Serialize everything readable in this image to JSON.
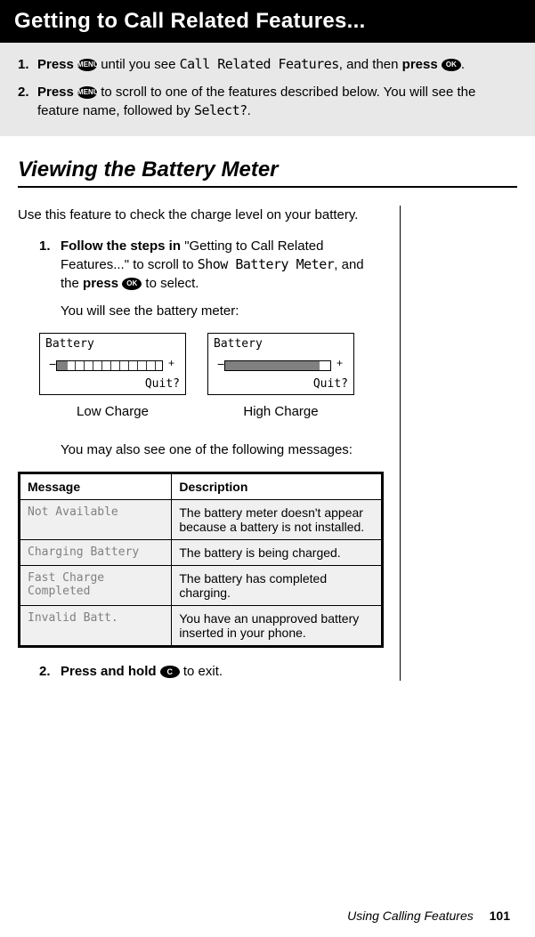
{
  "header": {
    "title": "Getting to Call Related Features..."
  },
  "steps": {
    "one_a": "Press ",
    "one_b": " until you see ",
    "one_menu": "Call Related Features",
    "one_c": ", and then ",
    "one_d": "press ",
    "one_e": ".",
    "two_a": "Press ",
    "two_b": " to scroll to one of the features described below. You will see the feature name, followed by ",
    "two_select": "Select?",
    "two_c": "."
  },
  "buttons": {
    "menu": "MENU",
    "ok": "OK",
    "c": "C"
  },
  "section": {
    "title": "Viewing the Battery Meter",
    "intro": "Use this feature to check the charge level on your battery.",
    "step1_a": "Follow the steps in ",
    "step1_b": "\"Getting to Call Related Features...\" to scroll to ",
    "step1_menu": "Show Battery Meter",
    "step1_c": ", and the ",
    "step1_d": "press ",
    "step1_e": " to select.",
    "step1_sub": "You will see the battery meter:",
    "meter": {
      "label": "Battery",
      "quit": "Quit?",
      "low_caption": "Low Charge",
      "high_caption": "High Charge"
    },
    "messages_intro": "You may also see one of the following messages:",
    "table": {
      "col1": "Message",
      "col2": "Description",
      "rows": [
        {
          "msg": "Not Available",
          "desc": "The battery meter doesn't appear because a battery is not installed."
        },
        {
          "msg": "Charging Battery",
          "desc": "The battery is being charged."
        },
        {
          "msg": "Fast Charge Completed",
          "desc": "The battery has completed charging."
        },
        {
          "msg": "Invalid Batt.",
          "desc": "You have an unapproved battery inserted in your phone."
        }
      ]
    },
    "step2_a": "Press and hold ",
    "step2_b": " to exit."
  },
  "footer": {
    "section": "Using Calling Features",
    "page": "101"
  }
}
